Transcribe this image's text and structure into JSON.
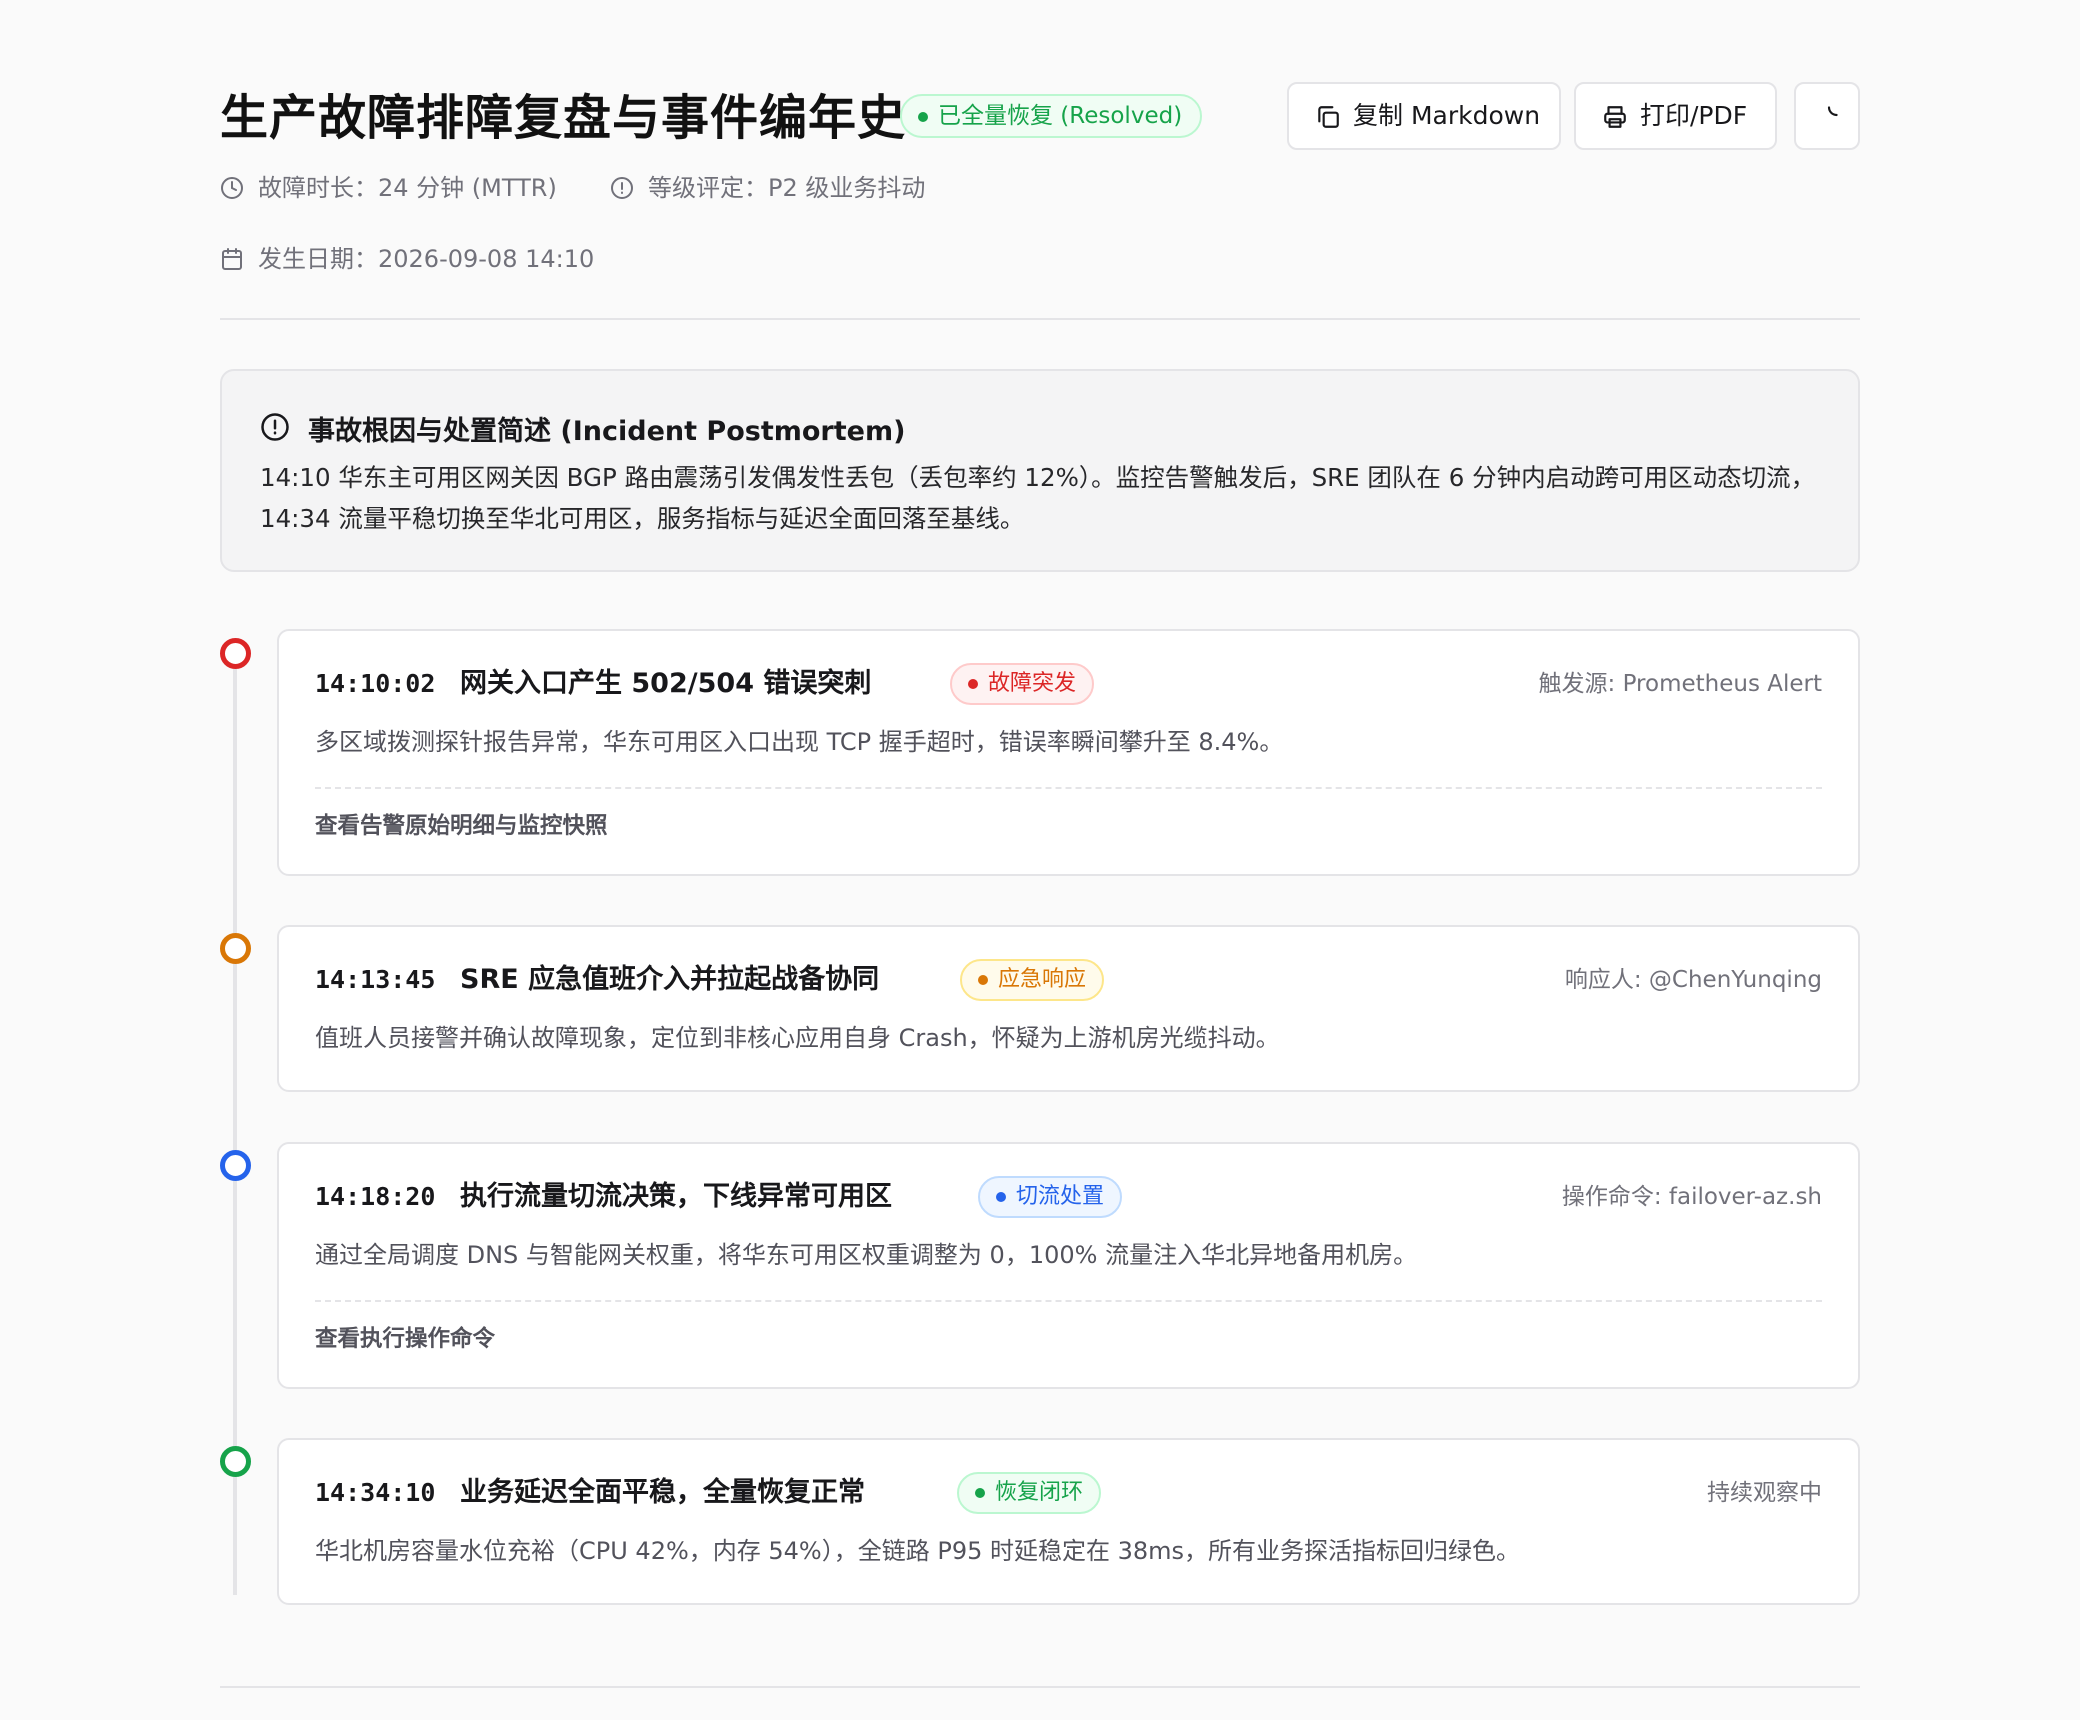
{
  "header": {
    "title": "生产故障排障复盘与事件编年史",
    "status_badge": "已全量恢复 (Resolved)",
    "copy_button": "复制 Markdown",
    "print_button": "打印/PDF",
    "meta_duration": "故障时长：24 分钟 (MTTR)",
    "meta_level": "等级评定：P2 级业务抖动",
    "meta_date": "发生日期：2026-09-08 14:10"
  },
  "summary": {
    "title": "事故根因与处置简述 (Incident Postmortem)",
    "body": "14:10 华东主可用区网关因 BGP 路由震荡引发偶发性丢包（丢包率约 12%）。监控告警触发后，SRE 团队在 6 分钟内启动跨可用区动态切流，14:34 流量平稳切换至华北可用区，服务指标与延迟全面回落至基线。"
  },
  "timeline": [
    {
      "time": "14:10:02",
      "title": "网关入口产生 502/504 错误突刺",
      "tag": "故障突发",
      "color": "#dc2626",
      "source": "触发源: Prometheus Alert",
      "desc": "多区域拨测探针报告异常，华东可用区入口出现 TCP 握手超时，错误率瞬间攀升至 8.4%。",
      "link": "查看告警原始明细与监控快照"
    },
    {
      "time": "14:13:45",
      "title": "SRE 应急值班介入并拉起战备协同",
      "tag": "应急响应",
      "color": "#d97706",
      "source": "响应人: @ChenYunqing",
      "desc": "值班人员接警并确认故障现象，定位到非核心应用自身 Crash，怀疑为上游机房光缆抖动。"
    },
    {
      "time": "14:18:20",
      "title": "执行流量切流决策，下线异常可用区",
      "tag": "切流处置",
      "color": "#2563eb",
      "source": "操作命令: failover-az.sh",
      "desc": "通过全局调度 DNS 与智能网关权重，将华东可用区权重调整为 0，100% 流量注入华北异地备用机房。",
      "link": "查看执行操作命令"
    },
    {
      "time": "14:34:10",
      "title": "业务延迟全面平稳，全量恢复正常",
      "tag": "恢复闭环",
      "color": "#16a34a",
      "source": "持续观察中",
      "desc": "华北机房容量水位充裕（CPU 42%，内存 54%），全链路 P95 时延稳定在 38ms，所有业务探活指标回归绿色。"
    }
  ],
  "icons": {
    "copy": "copy-icon",
    "print": "printer-icon",
    "theme": "moon-icon",
    "duration": "clock-icon",
    "level": "alert-circle-icon",
    "date": "calendar-icon",
    "summary": "alert-circle-icon"
  }
}
